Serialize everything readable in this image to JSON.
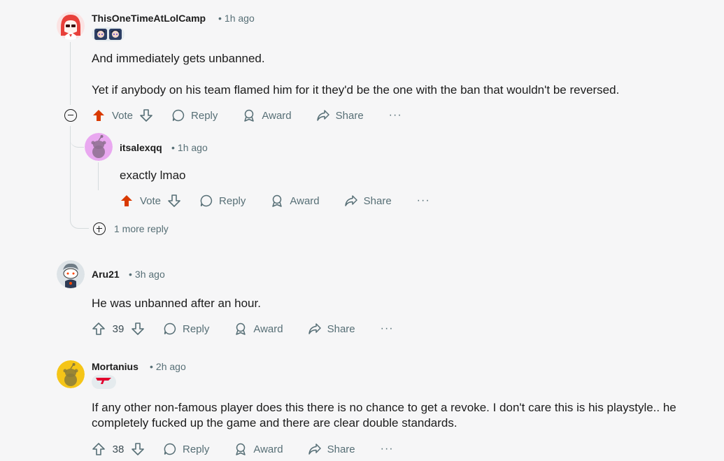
{
  "comments": [
    {
      "username": "ThisOneTimeAtLolCamp",
      "time": "1h ago",
      "paragraphs": [
        "And immediately gets unbanned.",
        "Yet if anybody on his team flamed him for it they'd be the one with the ban that wouldn't be reversed."
      ],
      "vote_label": "Vote",
      "reply_label": "Reply",
      "award_label": "Award",
      "share_label": "Share",
      "more_label": "···",
      "upvoted": true,
      "avatar_color": "#e8403a"
    },
    {
      "username": "itsalexqq",
      "time": "1h ago",
      "text": "exactly lmao",
      "vote_label": "Vote",
      "reply_label": "Reply",
      "award_label": "Award",
      "share_label": "Share",
      "more_label": "···",
      "upvoted": true,
      "avatar_color": "#e9a8f0"
    },
    {
      "username": "Aru21",
      "time": "3h ago",
      "text": "He was unbanned after an hour.",
      "score": "39",
      "reply_label": "Reply",
      "award_label": "Award",
      "share_label": "Share",
      "more_label": "···",
      "avatar_color": "#cfd6dc"
    },
    {
      "username": "Mortanius",
      "time": "2h ago",
      "text": "If any other non-famous player does this there is no chance to get a revoke. I don't care this is his playstyle.. he completely fucked up the game and there are clear double standards.",
      "score": "38",
      "reply_label": "Reply",
      "award_label": "Award",
      "share_label": "Share",
      "more_label": "···",
      "avatar_color": "#f5c518"
    }
  ],
  "more_replies_label": "1 more reply",
  "meta_dot": "•",
  "colors": {
    "upvote_active": "#d93a00",
    "muted": "#576f76",
    "thread_line": "#d5dbdd"
  }
}
